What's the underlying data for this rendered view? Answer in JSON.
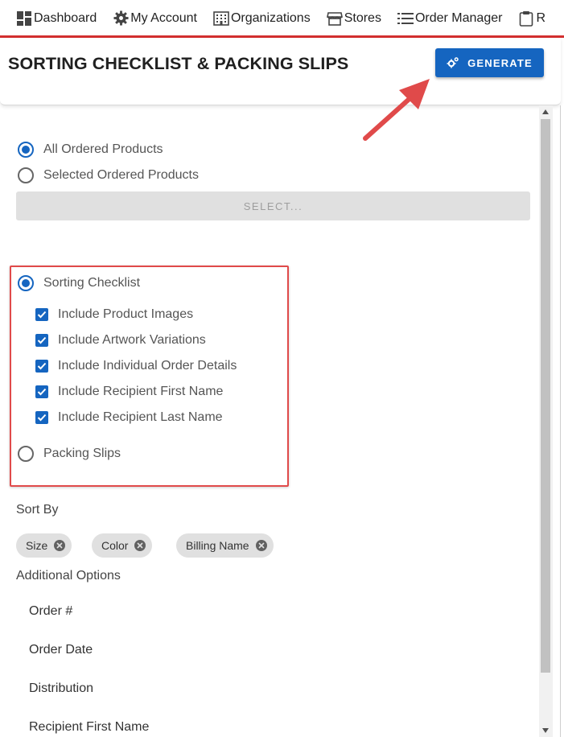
{
  "nav": {
    "items": [
      {
        "label": "Dashboard",
        "icon": "dashboard-icon"
      },
      {
        "label": "My Account",
        "icon": "gear-icon"
      },
      {
        "label": "Organizations",
        "icon": "building-icon"
      },
      {
        "label": "Stores",
        "icon": "store-icon"
      },
      {
        "label": "Order Manager",
        "icon": "list-icon"
      },
      {
        "label": "R",
        "icon": "clipboard-icon"
      }
    ],
    "accent_color": "#d32f2f"
  },
  "header": {
    "title": "SORTING CHECKLIST & PACKING SLIPS",
    "generate_label": "GENERATE"
  },
  "product_scope": {
    "options": [
      {
        "label": "All Ordered Products",
        "checked": true
      },
      {
        "label": "Selected Ordered Products",
        "checked": false
      }
    ],
    "select_label": "SELECT..."
  },
  "report_type": {
    "sorting_checklist": {
      "label": "Sorting Checklist",
      "checked": true
    },
    "checkboxes": [
      {
        "label": "Include Product Images",
        "checked": true
      },
      {
        "label": "Include Artwork Variations",
        "checked": true
      },
      {
        "label": "Include Individual Order Details",
        "checked": true
      },
      {
        "label": "Include Recipient First Name",
        "checked": true
      },
      {
        "label": "Include Recipient Last Name",
        "checked": true
      }
    ],
    "packing_slips": {
      "label": "Packing Slips",
      "checked": false
    }
  },
  "sort_by": {
    "label": "Sort By",
    "chips": [
      "Size",
      "Color",
      "Billing Name"
    ]
  },
  "additional_options": {
    "label": "Additional Options",
    "items": [
      "Order #",
      "Order Date",
      "Distribution",
      "Recipient First Name"
    ]
  },
  "colors": {
    "primary": "#1565c0",
    "annotation_red": "#e04a4a"
  }
}
